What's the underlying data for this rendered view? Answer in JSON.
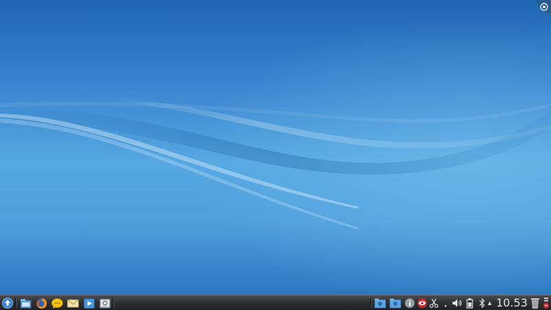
{
  "desktop": {
    "name": "desktop"
  },
  "taskbar": {
    "launcher": {
      "icon": "kde-kickoff-icon"
    },
    "quick_launch": [
      {
        "icon": "file-manager-icon"
      },
      {
        "icon": "firefox-icon"
      },
      {
        "icon": "chat-icon"
      },
      {
        "icon": "mail-icon"
      },
      {
        "icon": "media-player-icon"
      },
      {
        "icon": "screenshot-icon"
      }
    ],
    "tray": {
      "expand_arrow": "▴",
      "clock": "10.53"
    }
  },
  "colors": {
    "wallpaper_top": "#1f66b1",
    "wallpaper_mid": "#56a8e2",
    "taskbar": "#2e3033"
  }
}
